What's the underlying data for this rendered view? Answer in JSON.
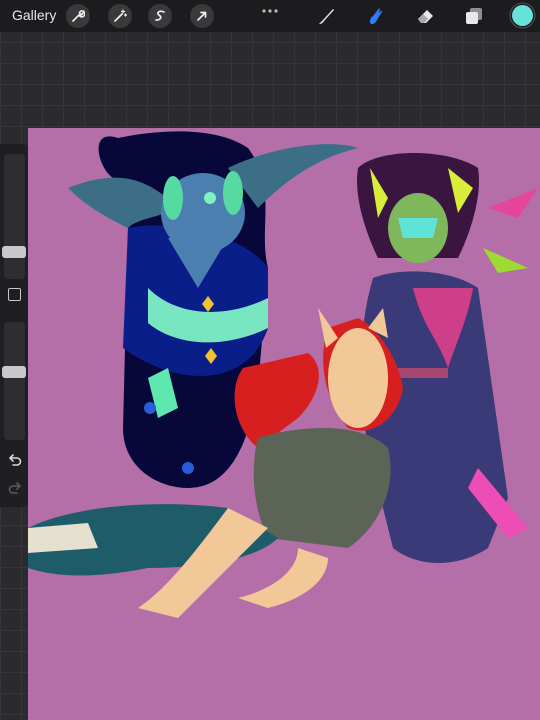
{
  "app": {
    "gallery_label": "Gallery"
  },
  "toolbar": {
    "left_tools": [
      "wrench-icon",
      "magic-wand-icon",
      "selection-icon",
      "transform-arrow-icon"
    ],
    "right_tools": [
      "brush-icon",
      "smudge-icon",
      "eraser-icon",
      "layers-icon"
    ],
    "active_tool": "smudge-icon",
    "current_color": "#66e3d9"
  },
  "sidebar": {
    "brush_size_level": 0.28,
    "opacity_level": 0.24
  },
  "canvas": {
    "background_color": "#b46fa8"
  },
  "colors": {
    "chrome": "#1c1c1e",
    "accent": "#2f7df6",
    "grid": "#2b2b2d"
  }
}
